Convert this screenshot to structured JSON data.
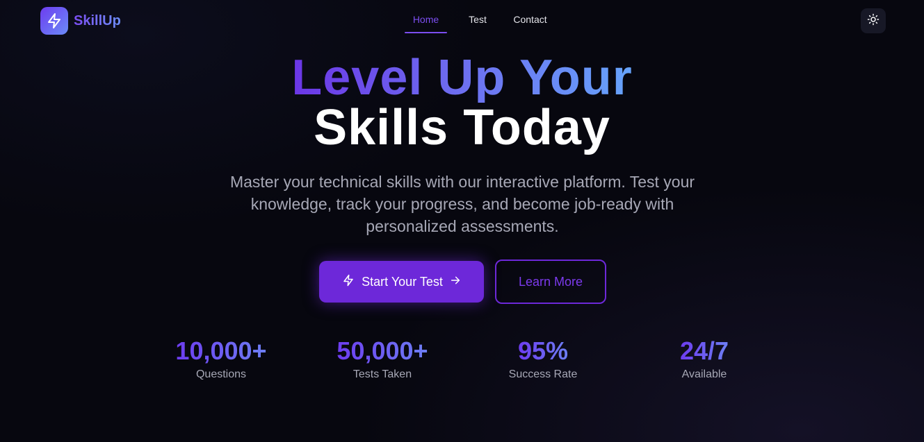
{
  "header": {
    "logo_text": "SkillUp",
    "logo_icon": "lightning-icon",
    "nav": [
      {
        "label": "Home",
        "active": true
      },
      {
        "label": "Test",
        "active": false
      },
      {
        "label": "Contact",
        "active": false
      }
    ],
    "theme_toggle_icon": "sun-icon"
  },
  "hero": {
    "title_line1": "Level Up Your",
    "title_line2": "Skills Today",
    "subtitle": "Master your technical skills with our interactive platform. Test your knowledge, track your progress, and become job-ready with personalized assessments."
  },
  "buttons": {
    "primary_label": "Start Your Test",
    "primary_icon_left": "lightning-icon",
    "primary_icon_right": "arrow-right-icon",
    "secondary_label": "Learn More"
  },
  "stats": [
    {
      "value": "10,000+",
      "label": "Questions"
    },
    {
      "value": "50,000+",
      "label": "Tests Taken"
    },
    {
      "value": "95%",
      "label": "Success Rate"
    },
    {
      "value": "24/7",
      "label": "Available"
    }
  ],
  "colors": {
    "background": "#07070f",
    "accent": "#6d28d9",
    "accent_light": "#7c4ef0",
    "gradient_blue": "#66a4fb",
    "muted_text": "#a7a8b6"
  }
}
